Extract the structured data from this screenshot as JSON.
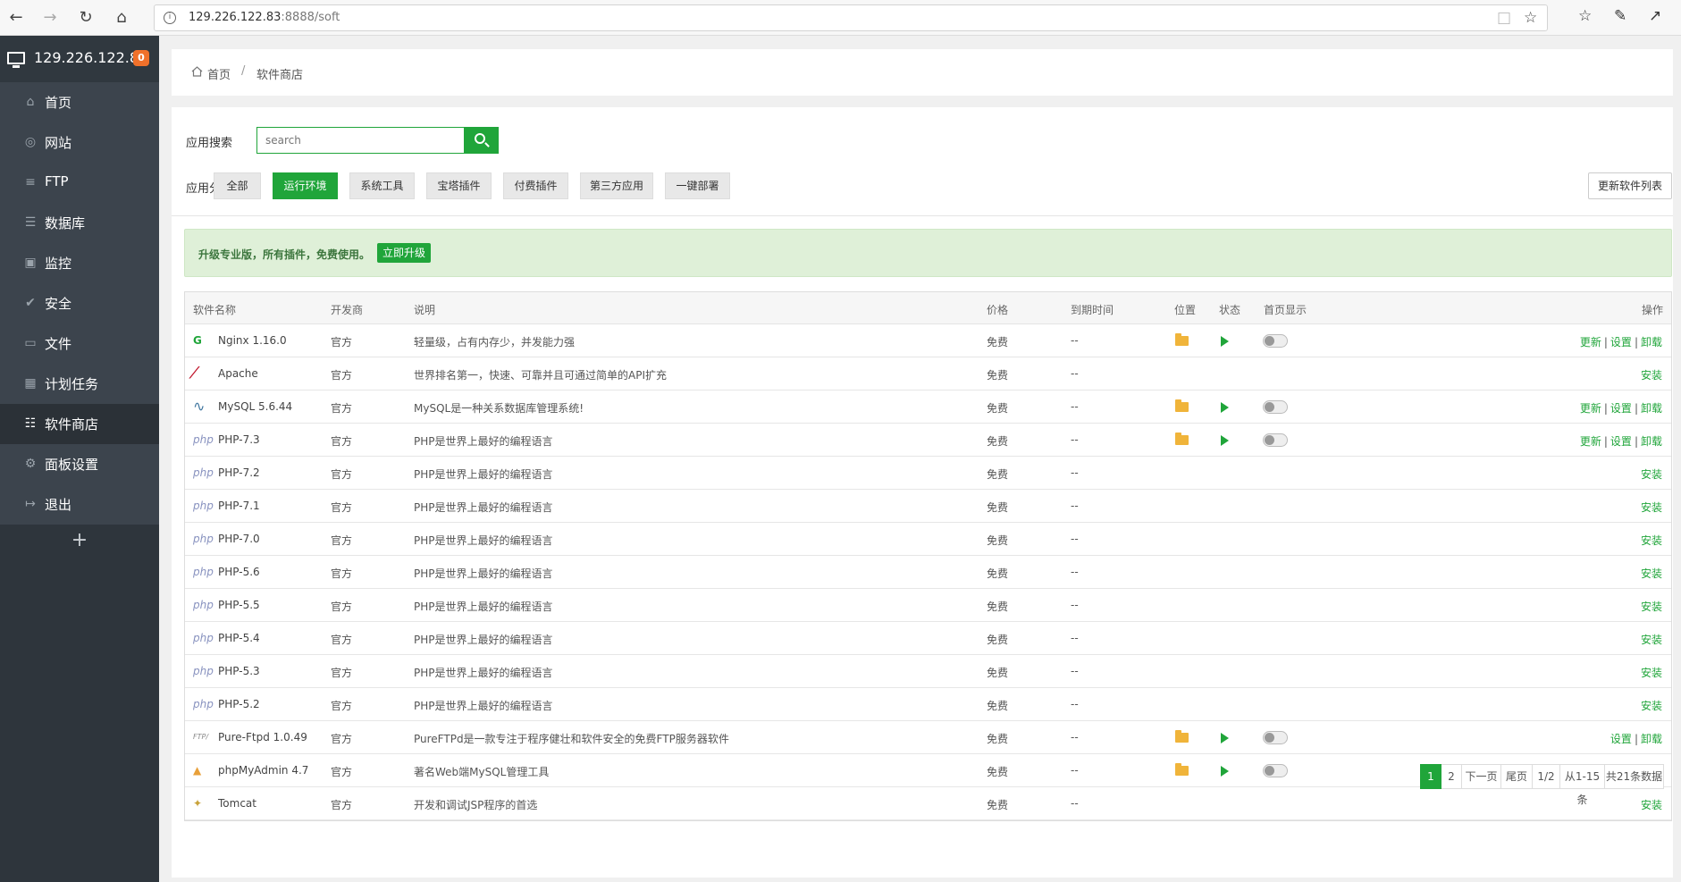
{
  "browser": {
    "url_host": "129.226.122.83",
    "url_rest": ":8888/soft"
  },
  "sidebar": {
    "server_ip": "129.226.122.83",
    "badge": "0",
    "items": [
      {
        "label": "首页",
        "icon": "home-icon"
      },
      {
        "label": "网站",
        "icon": "globe-icon"
      },
      {
        "label": "FTP",
        "icon": "ftp-icon"
      },
      {
        "label": "数据库",
        "icon": "database-icon"
      },
      {
        "label": "监控",
        "icon": "monitor-icon"
      },
      {
        "label": "安全",
        "icon": "shield-icon"
      },
      {
        "label": "文件",
        "icon": "folder-icon"
      },
      {
        "label": "计划任务",
        "icon": "calendar-icon"
      },
      {
        "label": "软件商店",
        "icon": "grid-icon"
      },
      {
        "label": "面板设置",
        "icon": "gear-icon"
      },
      {
        "label": "退出",
        "icon": "logout-icon"
      }
    ],
    "add": "+"
  },
  "breadcrumb": {
    "home": "首页",
    "separator": "/",
    "current": "软件商店"
  },
  "search": {
    "label": "应用搜索",
    "placeholder": "search"
  },
  "categories": {
    "label": "应用分类",
    "items": [
      "全部",
      "运行环境",
      "系统工具",
      "宝塔插件",
      "付费插件",
      "第三方应用",
      "一键部署"
    ],
    "active": "运行环境"
  },
  "refresh_button": "更新软件列表",
  "promo": {
    "text": "升级专业版，所有插件，免费使用。",
    "button": "立即升级"
  },
  "table": {
    "headers": [
      "软件名称",
      "开发商",
      "说明",
      "价格",
      "到期时间",
      "位置",
      "状态",
      "首页显示",
      "操作"
    ],
    "rows": [
      {
        "name": "Nginx 1.16.0",
        "dev": "官方",
        "desc": "轻量级，占有内存少，并发能力强",
        "price": "免费",
        "expire": "--",
        "installed": true,
        "ops": [
          "更新",
          "设置",
          "卸载"
        ]
      },
      {
        "name": "Apache",
        "dev": "官方",
        "desc": "世界排名第一，快速、可靠并且可通过简单的API扩充",
        "price": "免费",
        "expire": "--",
        "installed": false,
        "ops": [
          "安装"
        ]
      },
      {
        "name": "MySQL 5.6.44",
        "dev": "官方",
        "desc": "MySQL是一种关系数据库管理系统!",
        "price": "免费",
        "expire": "--",
        "installed": true,
        "ops": [
          "更新",
          "设置",
          "卸载"
        ]
      },
      {
        "name": "PHP-7.3",
        "dev": "官方",
        "desc": "PHP是世界上最好的编程语言",
        "price": "免费",
        "expire": "--",
        "installed": true,
        "ops": [
          "更新",
          "设置",
          "卸载"
        ]
      },
      {
        "name": "PHP-7.2",
        "dev": "官方",
        "desc": "PHP是世界上最好的编程语言",
        "price": "免费",
        "expire": "--",
        "installed": false,
        "ops": [
          "安装"
        ]
      },
      {
        "name": "PHP-7.1",
        "dev": "官方",
        "desc": "PHP是世界上最好的编程语言",
        "price": "免费",
        "expire": "--",
        "installed": false,
        "ops": [
          "安装"
        ]
      },
      {
        "name": "PHP-7.0",
        "dev": "官方",
        "desc": "PHP是世界上最好的编程语言",
        "price": "免费",
        "expire": "--",
        "installed": false,
        "ops": [
          "安装"
        ]
      },
      {
        "name": "PHP-5.6",
        "dev": "官方",
        "desc": "PHP是世界上最好的编程语言",
        "price": "免费",
        "expire": "--",
        "installed": false,
        "ops": [
          "安装"
        ]
      },
      {
        "name": "PHP-5.5",
        "dev": "官方",
        "desc": "PHP是世界上最好的编程语言",
        "price": "免费",
        "expire": "--",
        "installed": false,
        "ops": [
          "安装"
        ]
      },
      {
        "name": "PHP-5.4",
        "dev": "官方",
        "desc": "PHP是世界上最好的编程语言",
        "price": "免费",
        "expire": "--",
        "installed": false,
        "ops": [
          "安装"
        ]
      },
      {
        "name": "PHP-5.3",
        "dev": "官方",
        "desc": "PHP是世界上最好的编程语言",
        "price": "免费",
        "expire": "--",
        "installed": false,
        "ops": [
          "安装"
        ]
      },
      {
        "name": "PHP-5.2",
        "dev": "官方",
        "desc": "PHP是世界上最好的编程语言",
        "price": "免费",
        "expire": "--",
        "installed": false,
        "ops": [
          "安装"
        ]
      },
      {
        "name": "Pure-Ftpd 1.0.49",
        "dev": "官方",
        "desc": "PureFTPd是一款专注于程序健壮和软件安全的免费FTP服务器软件",
        "price": "免费",
        "expire": "--",
        "installed": true,
        "ops": [
          "设置",
          "卸载"
        ]
      },
      {
        "name": "phpMyAdmin 4.7",
        "dev": "官方",
        "desc": "著名Web端MySQL管理工具",
        "price": "免费",
        "expire": "--",
        "installed": true,
        "ops": [
          "设置",
          "卸载"
        ]
      },
      {
        "name": "Tomcat",
        "dev": "官方",
        "desc": "开发和调试JSP程序的首选",
        "price": "免费",
        "expire": "--",
        "installed": false,
        "ops": [
          "安装"
        ]
      }
    ]
  },
  "pager": {
    "items": [
      "1",
      "2",
      "下一页",
      "尾页",
      "1/2",
      "从1-15条",
      "共21条数据"
    ],
    "current": "1"
  },
  "colors": {
    "accent": "#20a53a",
    "sidebar": "#3c444d",
    "badge": "#f0712b",
    "promo_bg": "#dff0d8"
  }
}
